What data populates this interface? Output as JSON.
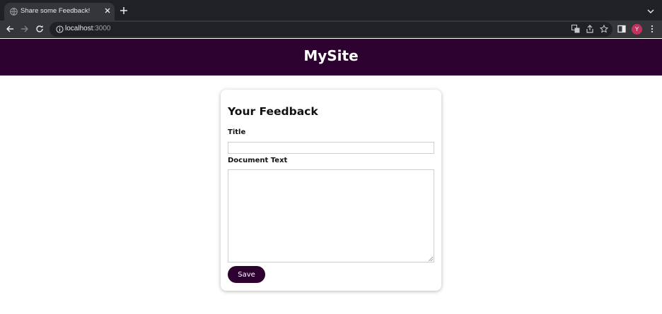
{
  "browser": {
    "tab_title": "Share some Feedback!",
    "url_host": "localhost",
    "url_port": ":3000",
    "profile_initial": "Y",
    "profile_color": "#c3325f"
  },
  "site": {
    "title": "MySite",
    "header_color": "#2d0230"
  },
  "form": {
    "heading": "Your Feedback",
    "title_label": "Title",
    "title_value": "",
    "text_label": "Document Text",
    "text_value": "",
    "save_label": "Save"
  }
}
